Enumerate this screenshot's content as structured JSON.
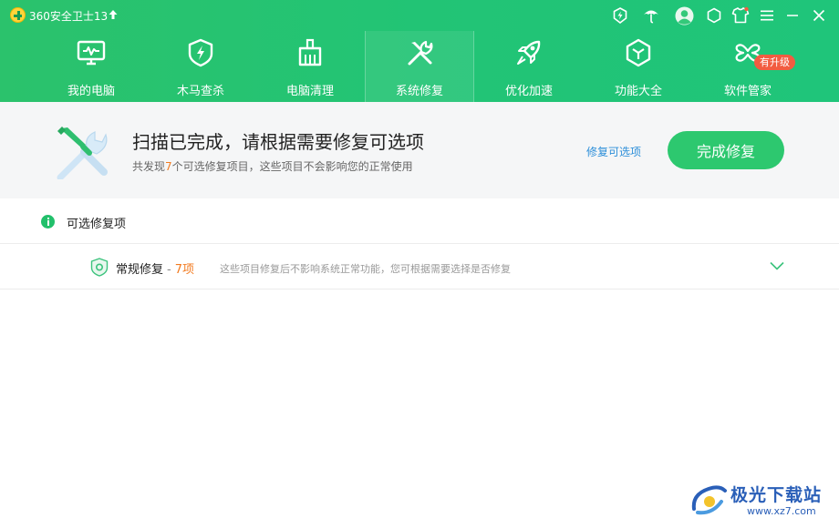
{
  "titlebar": {
    "app_title": "360安全卫士13",
    "icons": [
      "upgrade-arrow-icon",
      "shield-lightning-icon",
      "umbrella-icon",
      "user-avatar-icon",
      "skin-shirt-icon",
      "hexagon-settings-icon",
      "menu-icon",
      "minimize-icon",
      "close-icon"
    ]
  },
  "nav": {
    "items": [
      {
        "label": "我的电脑",
        "icon": "computer-icon"
      },
      {
        "label": "木马查杀",
        "icon": "shield-lightning-icon"
      },
      {
        "label": "电脑清理",
        "icon": "broom-icon"
      },
      {
        "label": "系统修复",
        "icon": "wrench-screwdriver-icon",
        "active": true
      },
      {
        "label": "优化加速",
        "icon": "rocket-icon"
      },
      {
        "label": "功能大全",
        "icon": "cube-icon"
      },
      {
        "label": "软件管家",
        "icon": "clover-icon",
        "badge": "有升级"
      }
    ]
  },
  "banner": {
    "title": "扫描已完成，请根据需要修复可选项",
    "sub_prefix": "共发现",
    "sub_count": "7",
    "sub_suffix": "个可选修复项目，这些项目不会影响您的正常使用",
    "options_link": "修复可选项",
    "finish_button": "完成修复"
  },
  "section": {
    "title": "可选修复项"
  },
  "repair_row": {
    "name": "常规修复",
    "separator": "-",
    "count": "7项",
    "description": "这些项目修复后不影响系统正常功能，您可根据需要选择是否修复"
  },
  "watermark": {
    "name": "极光下载站",
    "url": "www.xz7.com"
  },
  "colors": {
    "header_green": "#22c475",
    "button_green": "#2dc86f",
    "highlight_orange": "#f27a1f",
    "link_blue": "#2d8fd9",
    "badge_red": "#f25c41"
  }
}
